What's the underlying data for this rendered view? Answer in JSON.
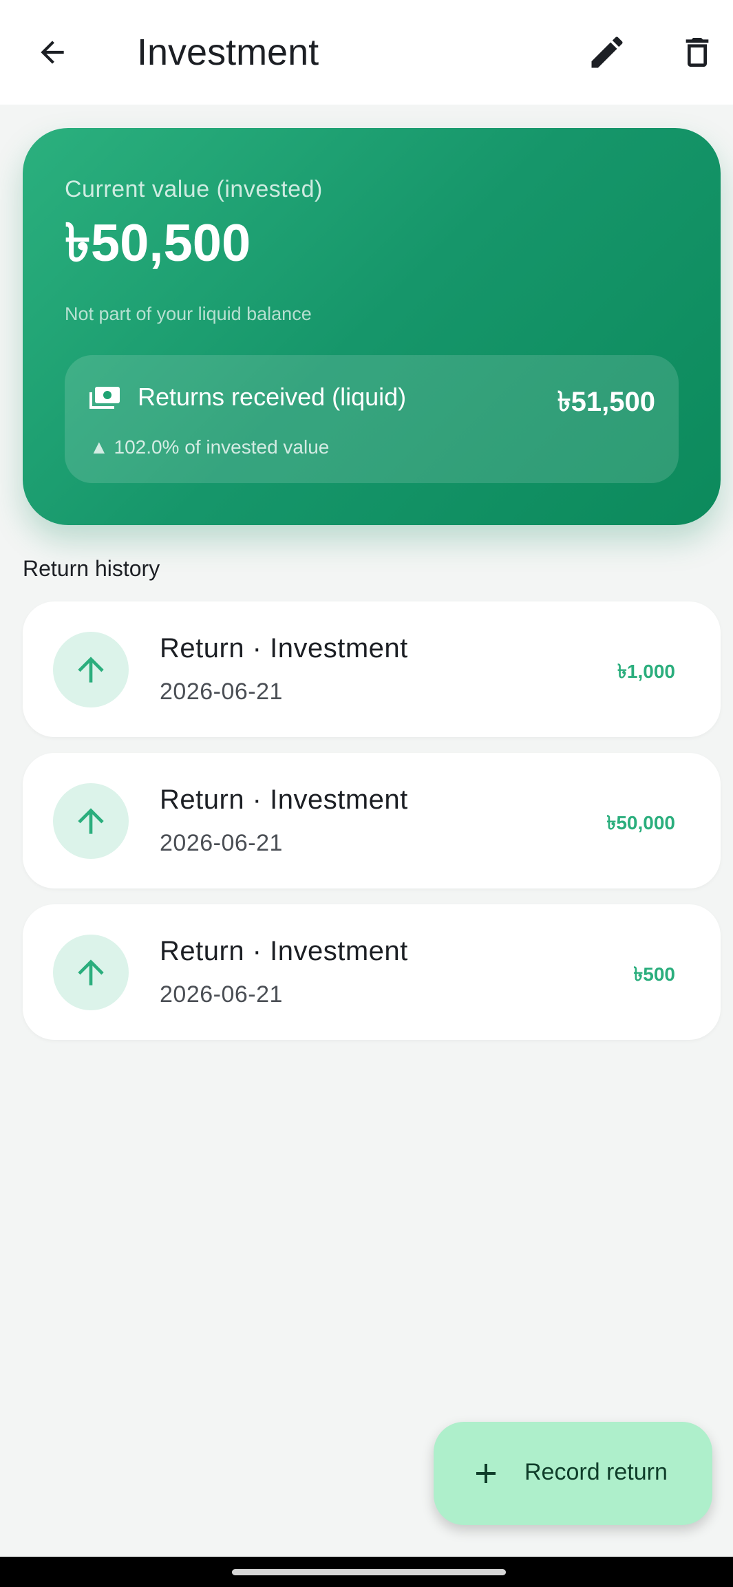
{
  "appbar": {
    "title": "Investment",
    "icons": {
      "back": "arrow-left-icon",
      "edit": "pencil-icon",
      "delete": "trash-icon"
    }
  },
  "hero": {
    "label": "Current value (invested)",
    "amount": "৳50,500",
    "note": "Not part of your liquid balance",
    "returns": {
      "icon": "cash-icon",
      "label": "Returns received (liquid)",
      "value": "৳51,500",
      "percent": "▲ 102.0% of invested value"
    }
  },
  "history": {
    "title": "Return history",
    "items": [
      {
        "title": "Return · Investment",
        "date": "2026-06-21",
        "amount": "৳1,000",
        "icon": "arrow-up-icon"
      },
      {
        "title": "Return · Investment",
        "date": "2026-06-21",
        "amount": "৳50,000",
        "icon": "arrow-up-icon"
      },
      {
        "title": "Return · Investment",
        "date": "2026-06-21",
        "amount": "৳500",
        "icon": "arrow-up-icon"
      }
    ]
  },
  "fab": {
    "label": "Record return",
    "icon": "plus-icon"
  },
  "colors": {
    "accent": "#16966a",
    "positive": "#2bae7d",
    "fab": "#aeefcb"
  }
}
